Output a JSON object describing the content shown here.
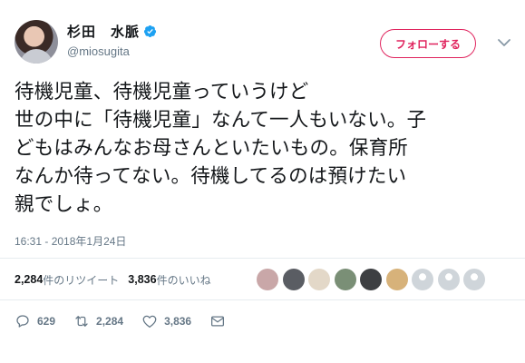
{
  "author": {
    "display_name": "杉田　水脈",
    "handle": "@miosugita",
    "verified": true
  },
  "follow_button": {
    "label": "フォローする"
  },
  "tweet": {
    "lines": [
      "待機児童、待機児童っていうけど",
      "世の中に「待機児童」なんて一人もいない。子",
      "どもはみんなお母さんといたいもの。保育所",
      "なんか待ってない。待機してるのは預けたい",
      "親でしょ。"
    ],
    "timestamp": "16:31 - 2018年1月24日"
  },
  "stats": {
    "retweets_count": "2,284",
    "retweets_label": "件のリツイート",
    "likes_count": "3,836",
    "likes_label": "件のいいね"
  },
  "likers": {
    "avatar_colors": [
      "#c9a7a8",
      "#5a5d63",
      "#e3d8c8",
      "#7a8f76",
      "#3d3f42",
      "#d7b27a",
      "#cfd5da",
      "#cfd5da",
      "#cfd5da"
    ]
  },
  "actions": {
    "reply_count": "629",
    "retweet_count": "2,284",
    "like_count": "3,836"
  },
  "colors": {
    "accent": "#e0245e",
    "verified": "#1da1f2",
    "muted": "#657786",
    "text": "#14171a"
  },
  "icons": [
    "verified-badge-icon",
    "chevron-down-icon",
    "reply-icon",
    "retweet-icon",
    "like-heart-icon",
    "direct-message-icon"
  ]
}
